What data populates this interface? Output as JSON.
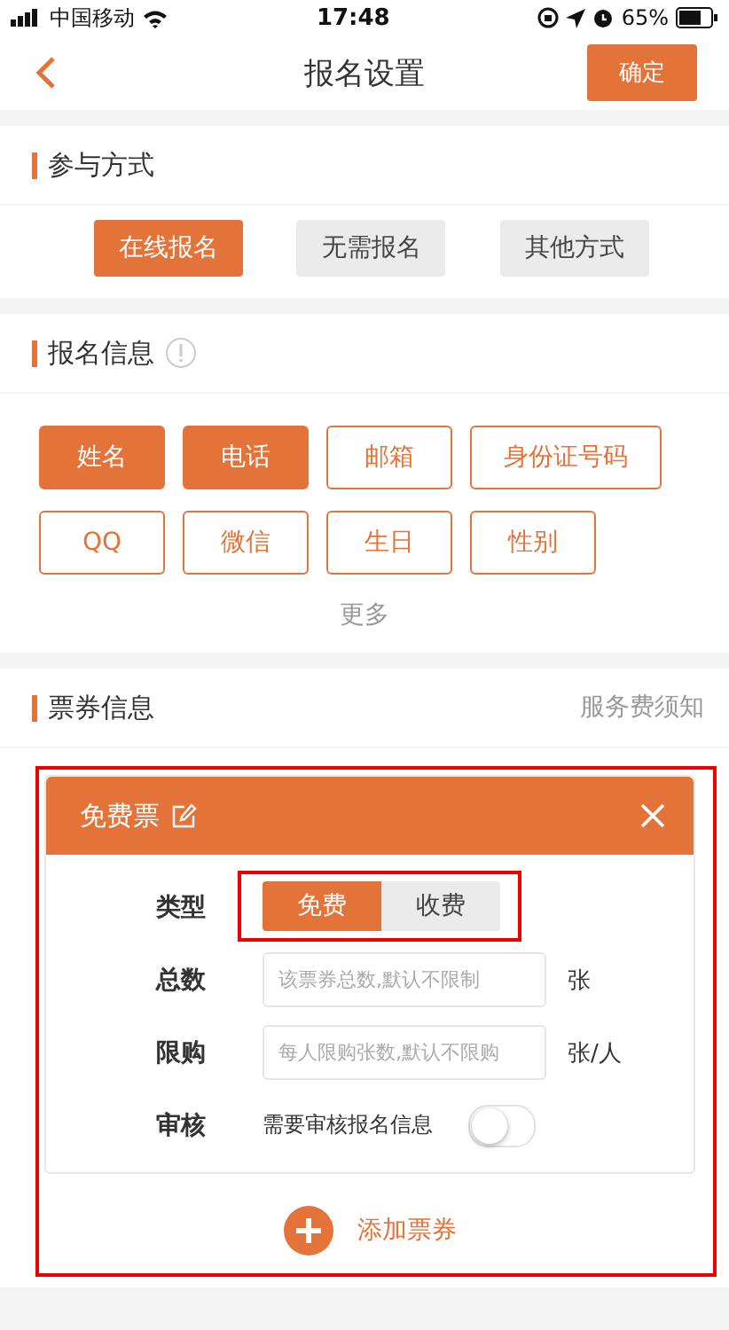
{
  "status_bar": {
    "carrier": "中国移动",
    "time": "17:48",
    "battery": "65%"
  },
  "nav": {
    "title": "报名设置",
    "confirm": "确定"
  },
  "participation": {
    "title": "参与方式",
    "options": [
      {
        "label": "在线报名",
        "selected": true
      },
      {
        "label": "无需报名",
        "selected": false
      },
      {
        "label": "其他方式",
        "selected": false
      }
    ]
  },
  "signup_info": {
    "title": "报名信息",
    "fields": [
      {
        "label": "姓名",
        "selected": true
      },
      {
        "label": "电话",
        "selected": true
      },
      {
        "label": "邮箱",
        "selected": false
      },
      {
        "label": "身份证号码",
        "selected": false
      },
      {
        "label": "QQ",
        "selected": false
      },
      {
        "label": "微信",
        "selected": false
      },
      {
        "label": "生日",
        "selected": false
      },
      {
        "label": "性别",
        "selected": false
      }
    ],
    "more": "更多"
  },
  "tickets": {
    "title": "票券信息",
    "link": "服务费须知",
    "highlighted": true,
    "cards": [
      {
        "name": "免费票",
        "type_label": "类型",
        "type_highlighted": true,
        "types": [
          {
            "label": "免费",
            "selected": true
          },
          {
            "label": "收费",
            "selected": false
          }
        ],
        "fields": [
          {
            "label": "总数",
            "placeholder": "该票券总数,默认不限制",
            "unit": "张"
          },
          {
            "label": "限购",
            "placeholder": "每人限购张数,默认不限购",
            "unit": "张/人"
          }
        ],
        "review": {
          "label": "审核",
          "text": "需要审核报名信息",
          "on": false
        }
      }
    ],
    "add": "添加票券"
  }
}
